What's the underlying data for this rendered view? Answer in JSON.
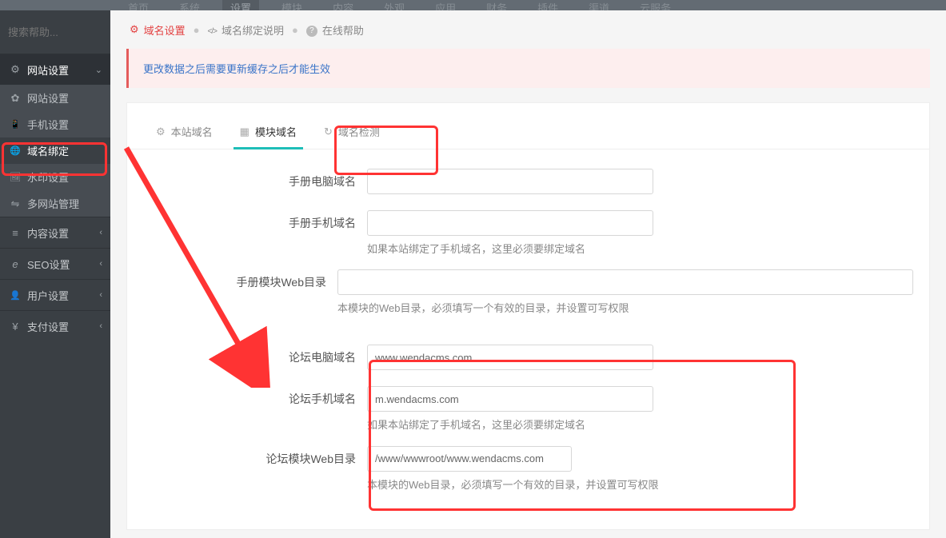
{
  "topnav": {
    "items": [
      "首页",
      "系统",
      "设置",
      "模块",
      "内容",
      "外观",
      "应用",
      "财务",
      "插件",
      "渠道",
      "云服务"
    ],
    "active_index": 2
  },
  "sidebar": {
    "search_placeholder": "搜索帮助...",
    "groups": [
      {
        "label": "网站设置",
        "icon": "gear",
        "open": true,
        "items": [
          {
            "label": "网站设置",
            "icon": "gear-o"
          },
          {
            "label": "手机设置",
            "icon": "phone"
          },
          {
            "label": "域名绑定",
            "icon": "globe",
            "active": true
          },
          {
            "label": "水印设置",
            "icon": "image"
          },
          {
            "label": "多网站管理",
            "icon": "share"
          }
        ]
      },
      {
        "label": "内容设置",
        "icon": "list",
        "open": false
      },
      {
        "label": "SEO设置",
        "icon": "ie",
        "open": false
      },
      {
        "label": "用户设置",
        "icon": "user",
        "open": false
      },
      {
        "label": "支付设置",
        "icon": "yen",
        "open": false
      }
    ]
  },
  "crumbs": {
    "primary": "域名设置",
    "secondary": "域名绑定说明",
    "help": "在线帮助"
  },
  "alert": "更改数据之后需要更新缓存之后才能生效",
  "tabs": {
    "items": [
      {
        "label": "本站域名",
        "icon": "gear"
      },
      {
        "label": "模块域名",
        "icon": "grid",
        "active": true
      },
      {
        "label": "域名检测",
        "icon": "refresh"
      }
    ]
  },
  "form": {
    "rows": [
      {
        "label": "手册电脑域名",
        "value": "",
        "help": ""
      },
      {
        "label": "手册手机域名",
        "value": "",
        "help": "如果本站绑定了手机域名，这里必须要绑定域名"
      },
      {
        "label": "手册模块Web目录",
        "value": "",
        "help": "本模块的Web目录，必须填写一个有效的目录，并设置可写权限"
      },
      {
        "label": "论坛电脑域名",
        "value": "www.wendacms.com",
        "help": ""
      },
      {
        "label": "论坛手机域名",
        "value": "m.wendacms.com",
        "help": "如果本站绑定了手机域名，这里必须要绑定域名"
      },
      {
        "label": "论坛模块Web目录",
        "value": "/www/wwwroot/www.wendacms.com",
        "help": "本模块的Web目录，必须填写一个有效的目录，并设置可写权限"
      }
    ]
  }
}
